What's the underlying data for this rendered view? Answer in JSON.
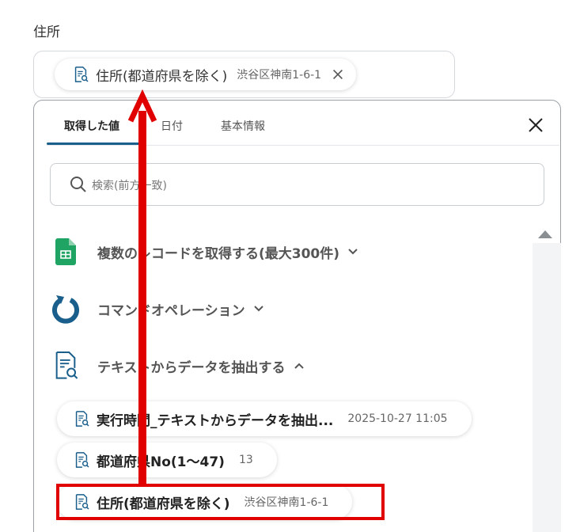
{
  "field": {
    "label": "住所"
  },
  "selected_chip": {
    "name": "住所(都道府県を除く)",
    "value": "渋谷区神南1-6-1",
    "icon": "document-search-icon",
    "remove_icon": "close-icon"
  },
  "panel": {
    "tabs": [
      {
        "label": "取得した値",
        "active": true
      },
      {
        "label": "日付",
        "active": false
      },
      {
        "label": "基本情報",
        "active": false
      }
    ],
    "close_icon": "close-icon",
    "search": {
      "placeholder": "検索(前方一致)",
      "icon": "search-icon"
    },
    "groups": [
      {
        "label": "複数のレコードを取得する(最大300件)",
        "icon": "google-sheets-icon",
        "expanded": false
      },
      {
        "label": "コマンドオペレーション",
        "icon": "refresh-circle-icon",
        "expanded": false
      },
      {
        "label": "テキストからデータを抽出する",
        "icon": "document-search-icon",
        "expanded": true
      }
    ],
    "items": [
      {
        "name": "実行時間_テキストからデータを抽出...",
        "value": "2025-10-27 11:05"
      },
      {
        "name": "都道府県No(1〜47)",
        "value": "13"
      },
      {
        "name": "住所(都道府県を除く)",
        "value": "渋谷区神南1-6-1"
      }
    ]
  },
  "annotation": {
    "color": "#e00000"
  }
}
